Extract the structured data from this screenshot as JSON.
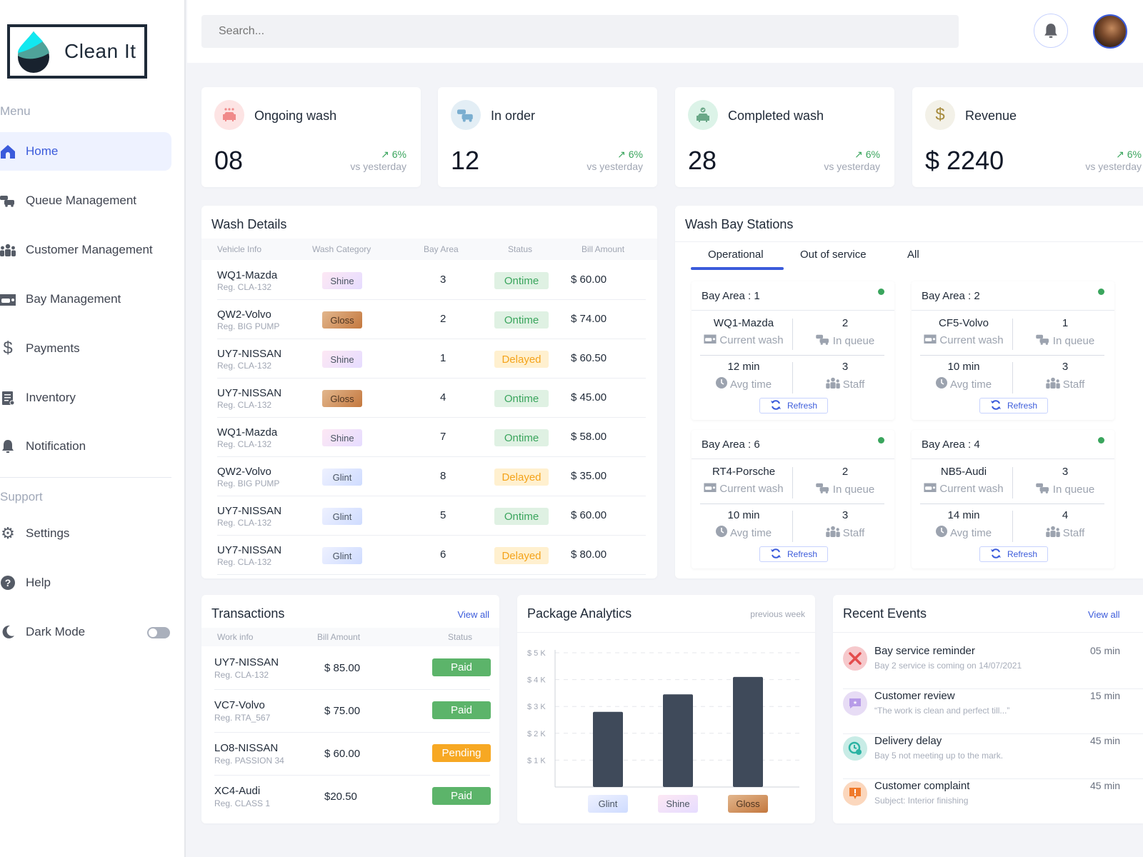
{
  "app": {
    "name": "Clean It"
  },
  "sidebar": {
    "menu_label": "Menu",
    "items": [
      {
        "label": "Home",
        "icon": "home-icon",
        "active": true
      },
      {
        "label": "Queue Management",
        "icon": "cars-icon"
      },
      {
        "label": "Customer Management",
        "icon": "users-icon"
      },
      {
        "label": "Bay Management",
        "icon": "car-wash-icon"
      },
      {
        "label": "Payments",
        "icon": "dollar-icon"
      },
      {
        "label": "Inventory",
        "icon": "clipboard-icon"
      },
      {
        "label": "Notification",
        "icon": "bell-icon"
      }
    ],
    "support_label": "Support",
    "support_items": [
      {
        "label": "Settings",
        "icon": "gear-icon"
      },
      {
        "label": "Help",
        "icon": "help-icon"
      },
      {
        "label": "Dark Mode",
        "icon": "moon-icon",
        "toggle": false
      }
    ]
  },
  "topbar": {
    "search_placeholder": "Search..."
  },
  "stats": [
    {
      "title": "Ongoing wash",
      "value": "08",
      "trend": "6%",
      "sub": "vs yesterday",
      "color": "#f08a8a",
      "bg": "#fde4e4"
    },
    {
      "title": "In order",
      "value": "12",
      "trend": "6%",
      "sub": "vs yesterday",
      "color": "#7aaed0",
      "bg": "#e3eef5"
    },
    {
      "title": "Completed wash",
      "value": "28",
      "trend": "6%",
      "sub": "vs yesterday",
      "color": "#6aa888",
      "bg": "#dcf3e8"
    },
    {
      "title": "Revenue",
      "value": "$ 2240",
      "trend": "6%",
      "sub": "vs yesterday",
      "color": "#a68a3c",
      "bg": "#f3f1e8"
    }
  ],
  "wash_details": {
    "title": "Wash Details",
    "columns": [
      "Vehicle Info",
      "Wash Category",
      "Bay Area",
      "Status",
      "Bill Amount"
    ],
    "rows": [
      {
        "vehicle": "WQ1-Mazda",
        "reg": "Reg. CLA-132",
        "category": "Shine",
        "bay": "3",
        "status": "Ontime",
        "amount": "$ 60.00"
      },
      {
        "vehicle": "QW2-Volvo",
        "reg": "Reg. BIG PUMP",
        "category": "Gloss",
        "bay": "2",
        "status": "Ontime",
        "amount": "$ 74.00"
      },
      {
        "vehicle": "UY7-NISSAN",
        "reg": "Reg. CLA-132",
        "category": "Shine",
        "bay": "1",
        "status": "Delayed",
        "amount": "$ 60.50"
      },
      {
        "vehicle": "UY7-NISSAN",
        "reg": "Reg. CLA-132",
        "category": "Gloss",
        "bay": "4",
        "status": "Ontime",
        "amount": "$ 45.00"
      },
      {
        "vehicle": "WQ1-Mazda",
        "reg": "Reg. CLA-132",
        "category": "Shine",
        "bay": "7",
        "status": "Ontime",
        "amount": "$ 58.00"
      },
      {
        "vehicle": "QW2-Volvo",
        "reg": "Reg. BIG PUMP",
        "category": "Glint",
        "bay": "8",
        "status": "Delayed",
        "amount": "$ 35.00"
      },
      {
        "vehicle": "UY7-NISSAN",
        "reg": "Reg. CLA-132",
        "category": "Glint",
        "bay": "5",
        "status": "Ontime",
        "amount": "$ 60.00"
      },
      {
        "vehicle": "UY7-NISSAN",
        "reg": "Reg. CLA-132",
        "category": "Glint",
        "bay": "6",
        "status": "Delayed",
        "amount": "$ 80.00"
      }
    ]
  },
  "bays": {
    "title": "Wash Bay Stations",
    "tabs": [
      {
        "label": "Operational",
        "active": true
      },
      {
        "label": "Out of service"
      },
      {
        "label": "All"
      }
    ],
    "current_wash_label": "Current wash",
    "in_queue_label": "In queue",
    "avg_time_label": "Avg time",
    "staff_label": "Staff",
    "refresh_label": "Refresh",
    "cards": [
      {
        "title": "Bay Area : 1",
        "vehicle": "WQ1-Mazda",
        "queue": "2",
        "avg": "12 min",
        "staff": "3"
      },
      {
        "title": "Bay Area : 2",
        "vehicle": "CF5-Volvo",
        "queue": "1",
        "avg": "10 min",
        "staff": "3"
      },
      {
        "title": "Bay Area : 6",
        "vehicle": "RT4-Porsche",
        "queue": "2",
        "avg": "10 min",
        "staff": "3"
      },
      {
        "title": "Bay Area : 4",
        "vehicle": "NB5-Audi",
        "queue": "3",
        "avg": "14 min",
        "staff": "4"
      }
    ]
  },
  "transactions": {
    "title": "Transactions",
    "view_all": "View all",
    "columns": [
      "Work info",
      "Bill Amount",
      "Status"
    ],
    "rows": [
      {
        "vehicle": "UY7-NISSAN",
        "reg": "Reg. CLA-132",
        "amount": "$ 85.00",
        "status": "Paid"
      },
      {
        "vehicle": "VC7-Volvo",
        "reg": "Reg. RTA_567",
        "amount": "$ 75.00",
        "status": "Paid"
      },
      {
        "vehicle": "LO8-NISSAN",
        "reg": "Reg. PASSION 34",
        "amount": "$ 60.00",
        "status": "Pending"
      },
      {
        "vehicle": "XC4-Audi",
        "reg": "Reg. CLASS 1",
        "amount": "$20.50",
        "status": "Paid"
      }
    ]
  },
  "package_analytics": {
    "title": "Package Analytics",
    "period": "previous week"
  },
  "chart_data": {
    "type": "bar",
    "title": "Package Analytics",
    "subtitle": "previous week",
    "categories": [
      "Glint",
      "Shine",
      "Gloss"
    ],
    "values": [
      2800,
      3450,
      4100
    ],
    "ylim": [
      0,
      5000
    ],
    "yticks": [
      1000,
      2000,
      3000,
      4000,
      5000
    ],
    "ytick_labels": [
      "$ 1 K",
      "$ 2 K",
      "$ 3 K",
      "$ 4 K",
      "$ 5 K"
    ],
    "xlabel": "",
    "ylabel": "",
    "grid": true,
    "bar_color": "#3f4a5a"
  },
  "events": {
    "title": "Recent Events",
    "view_all": "View all",
    "items": [
      {
        "title": "Bay service reminder",
        "sub": "Bay 2 service is coming on 14/07/2021",
        "time": "05 min",
        "icon": "tools-icon",
        "bg": "#f6c9cc",
        "fg": "#e44c4c"
      },
      {
        "title": "Customer review",
        "sub": "“The work is clean and perfect till...”",
        "time": "15 min",
        "icon": "review-icon",
        "bg": "#e7dcf5",
        "fg": "#b79be8"
      },
      {
        "title": "Delivery delay",
        "sub": "Bay 5 not meeting up to the mark.",
        "time": "45 min",
        "icon": "clock-alert-icon",
        "bg": "#c8ece6",
        "fg": "#2bb3a3"
      },
      {
        "title": "Customer complaint",
        "sub": "Subject: Interior finishing",
        "time": "45 min",
        "icon": "complaint-icon",
        "bg": "#fbd7bd",
        "fg": "#f07a2a"
      }
    ]
  }
}
